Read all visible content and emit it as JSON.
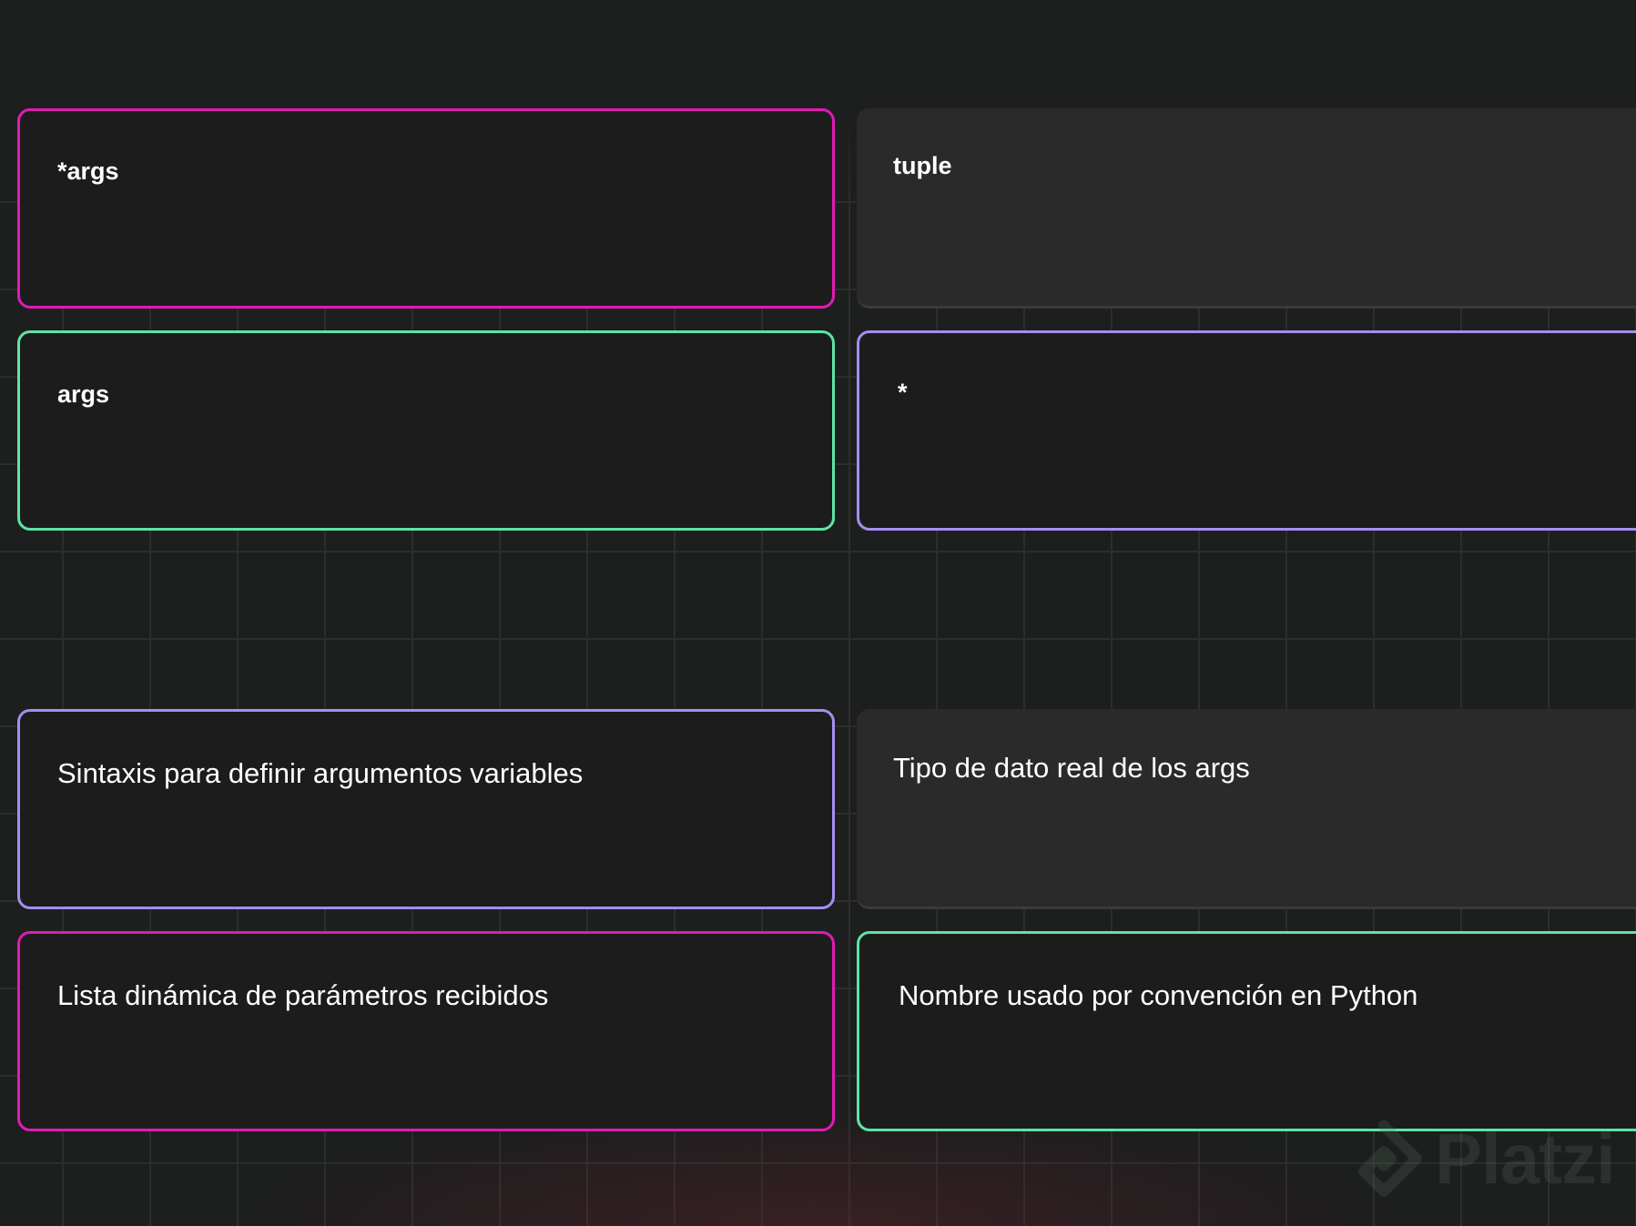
{
  "cards": [
    {
      "text": "*args",
      "style": "pink"
    },
    {
      "text": "tuple",
      "style": "plain"
    },
    {
      "text": "args",
      "style": "green"
    },
    {
      "text": "*",
      "style": "purple"
    },
    {
      "text": "Sintaxis para definir argumentos variables",
      "style": "purple"
    },
    {
      "text": "Tipo de dato real de los args",
      "style": "plain"
    },
    {
      "text": "Lista dinámica de parámetros recibidos",
      "style": "pink"
    },
    {
      "text": "Nombre usado por convención en Python",
      "style": "green"
    }
  ],
  "watermark": {
    "text": "Platzi",
    "icon": "platzi-logo-icon"
  },
  "colors": {
    "pink": "#e01bb4",
    "green": "#5fe3a4",
    "purple": "#a48ef0",
    "background": "#1d1e1e",
    "card_plain": "#2a2a2b"
  }
}
